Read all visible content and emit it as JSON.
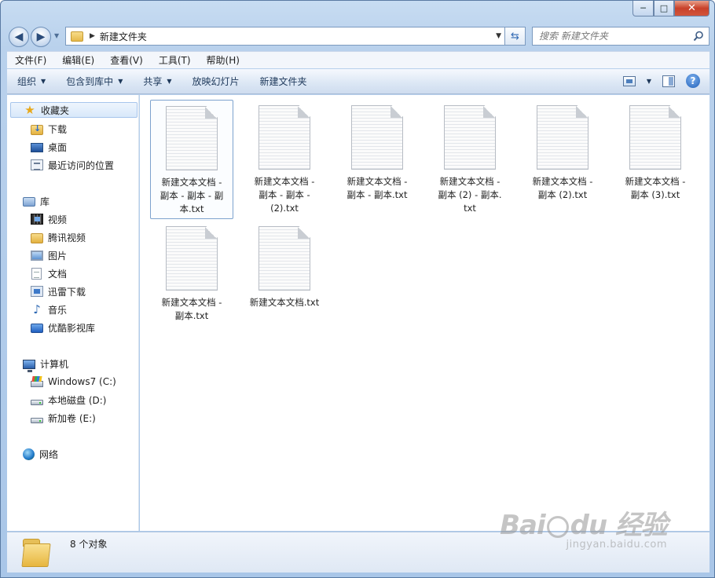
{
  "window": {
    "caption": {
      "minimize": "─",
      "maximize": "□",
      "close": "✕"
    }
  },
  "navigation": {
    "address_path": "新建文件夹",
    "search_placeholder": "搜索 新建文件夹"
  },
  "menu": [
    "文件(F)",
    "编辑(E)",
    "查看(V)",
    "工具(T)",
    "帮助(H)"
  ],
  "commands": [
    {
      "label": "组织",
      "dropdown": true
    },
    {
      "label": "包含到库中",
      "dropdown": true
    },
    {
      "label": "共享",
      "dropdown": true
    },
    {
      "label": "放映幻灯片",
      "dropdown": false
    },
    {
      "label": "新建文件夹",
      "dropdown": false
    }
  ],
  "nav_pane": {
    "favorites": {
      "label": "收藏夹",
      "icon": "star-icon",
      "items": [
        {
          "label": "下载",
          "icon": "downloads-folder-icon"
        },
        {
          "label": "桌面",
          "icon": "desktop-icon"
        },
        {
          "label": "最近访问的位置",
          "icon": "recent-places-icon"
        }
      ]
    },
    "libraries": {
      "label": "库",
      "icon": "library-icon",
      "items": [
        {
          "label": "视频",
          "icon": "video-library-icon"
        },
        {
          "label": "腾讯视频",
          "icon": "folder-icon"
        },
        {
          "label": "图片",
          "icon": "pictures-library-icon"
        },
        {
          "label": "文档",
          "icon": "documents-library-icon"
        },
        {
          "label": "迅雷下载",
          "icon": "thunder-download-icon"
        },
        {
          "label": "音乐",
          "icon": "music-library-icon"
        },
        {
          "label": "优酷影视库",
          "icon": "youku-library-icon"
        }
      ]
    },
    "computer": {
      "label": "计算机",
      "icon": "computer-icon",
      "items": [
        {
          "label": "Windows7 (C:)",
          "icon": "system-drive-icon"
        },
        {
          "label": "本地磁盘 (D:)",
          "icon": "local-disk-icon"
        },
        {
          "label": "新加卷 (E:)",
          "icon": "local-disk-icon"
        }
      ]
    },
    "network": {
      "label": "网络",
      "icon": "network-icon"
    }
  },
  "files": [
    {
      "name": "新建文本文档 -\n副本 - 副本 - 副\n本.txt",
      "selected": true
    },
    {
      "name": "新建文本文档 -\n副本 - 副本 -\n(2).txt",
      "selected": false
    },
    {
      "name": "新建文本文档 -\n副本 - 副本.txt",
      "selected": false
    },
    {
      "name": "新建文本文档 -\n副本 (2) - 副本.\ntxt",
      "selected": false
    },
    {
      "name": "新建文本文档 -\n副本 (2).txt",
      "selected": false
    },
    {
      "name": "新建文本文档 -\n副本 (3).txt",
      "selected": false
    },
    {
      "name": "新建文本文档 -\n副本.txt",
      "selected": false
    },
    {
      "name": "新建文本文档.txt",
      "selected": false
    }
  ],
  "details": {
    "count": "8 个对象"
  },
  "watermark": {
    "brand": "Bai",
    "brand2": "du",
    "cn": "经验",
    "url": "jingyan.baidu.com"
  }
}
